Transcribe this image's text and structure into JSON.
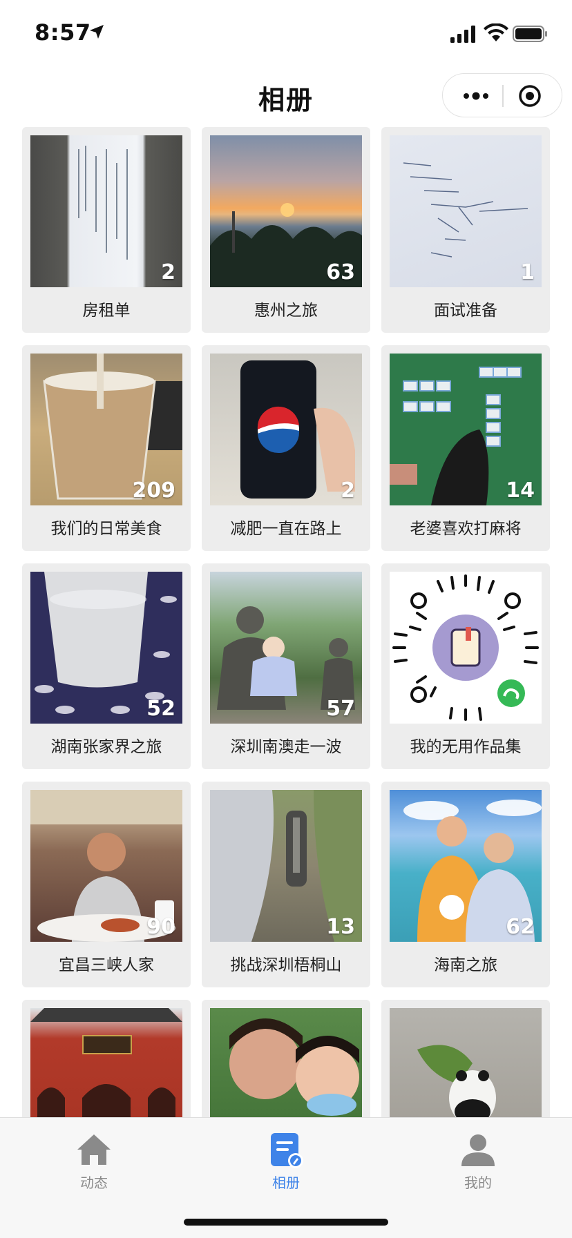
{
  "status": {
    "time": "8:57"
  },
  "nav": {
    "title": "相册"
  },
  "albums": [
    {
      "title": "房租单",
      "count": "2"
    },
    {
      "title": "惠州之旅",
      "count": "63"
    },
    {
      "title": "面试准备",
      "count": "1"
    },
    {
      "title": "我们的日常美食",
      "count": "209"
    },
    {
      "title": "减肥一直在路上",
      "count": "2"
    },
    {
      "title": "老婆喜欢打麻将",
      "count": "14"
    },
    {
      "title": "湖南张家界之旅",
      "count": "52"
    },
    {
      "title": "深圳南澳走一波",
      "count": "57"
    },
    {
      "title": "我的无用作品集",
      "count": ""
    },
    {
      "title": "宜昌三峡人家",
      "count": "90"
    },
    {
      "title": "挑战深圳梧桐山",
      "count": "13"
    },
    {
      "title": "海南之旅",
      "count": "62"
    },
    {
      "title": "",
      "count": ""
    },
    {
      "title": "",
      "count": ""
    },
    {
      "title": "",
      "count": ""
    }
  ],
  "tabs": [
    {
      "label": "动态",
      "icon": "home-icon"
    },
    {
      "label": "相册",
      "icon": "album-icon"
    },
    {
      "label": "我的",
      "icon": "profile-icon"
    }
  ],
  "colors": {
    "accent": "#3e83e8",
    "inactive": "#8a8a8a"
  }
}
